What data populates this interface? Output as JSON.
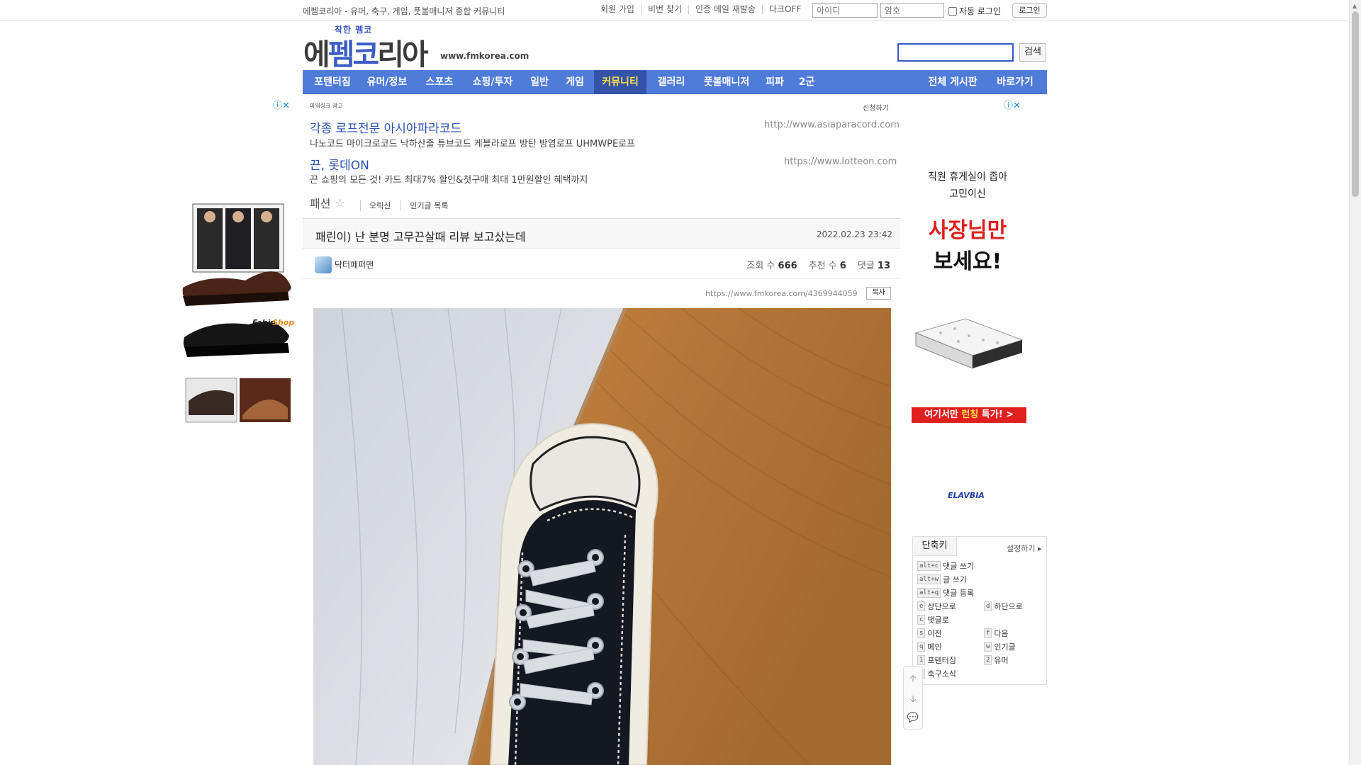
{
  "topbar": {
    "site_desc": "에펨코리아 - 유머, 축구, 게임, 풋볼매니저 종합 커뮤니티",
    "links": [
      "회원 가입",
      "비번 찾기",
      "인증 메일 재발송",
      "다크OFF"
    ],
    "id_placeholder": "아이디",
    "pw_placeholder": "암호",
    "auto_login": "자동 로그인",
    "login_button": "로그인"
  },
  "header": {
    "logo_small": "착한 펨코",
    "logo_text_a": "에",
    "logo_text_b": "펨",
    "logo_text_c": "코",
    "logo_text_d": "리아",
    "url": "www.fmkorea.com",
    "search_button": "검색"
  },
  "nav": {
    "items": [
      "포텐터짐",
      "유머/정보",
      "스포츠",
      "쇼핑/투자",
      "일반",
      "게임",
      "커뮤니티",
      "갤러리",
      "풋볼매니저",
      "피파",
      "2군"
    ],
    "active": "커뮤니티",
    "right_items": [
      "전체 게시판",
      "바로가기"
    ]
  },
  "ads": {
    "powerlink": "파워링크 광고",
    "apply": "신청하기",
    "items": [
      {
        "title": "각종 로프전문 아시아파라코드",
        "url": "http://www.asiaparacord.com",
        "desc": "나노코드 마이크로코드 낙하산줄 튜브코드 케블라로프 방탄 방염로프 UHMWPE로프"
      },
      {
        "title": "끈, 롯데ON",
        "url": "https://www.lotteon.com",
        "desc": "끈 쇼핑의 모든 것! 카드 최대7% 할인&첫구매 최대 1만원할인 혜택까지"
      }
    ]
  },
  "board": {
    "name": "패션",
    "links": [
      "오릭신",
      "인기글 목록"
    ]
  },
  "post": {
    "title": "패린이) 난 분명 고무끈살때 리뷰 보고샀는데",
    "date": "2022.02.23 23:42",
    "author": "닥터페퍼맨",
    "views_label": "조회 수",
    "views": "666",
    "recommend_label": "추천 수",
    "recommend": "6",
    "comments_label": "댓글",
    "comments": "13",
    "permalink": "https://www.fmkorea.com/4369944059",
    "copy_button": "복사"
  },
  "left_ad": {
    "brand": "FahinShop"
  },
  "right_ad": {
    "line1": "직원 휴게실이 좁아",
    "line2": "고민이신",
    "red": "사장님만",
    "black": "보세요!",
    "bar_a": "여기서만 ",
    "bar_b": "런칭",
    "bar_c": " 특가! >",
    "brand": "ELAVBIA"
  },
  "shortcuts": {
    "tab": "단축키",
    "settings": "설정하기",
    "rows": [
      {
        "key": "alt+c",
        "label": "댓글 쓰기"
      },
      {
        "key": "alt+w",
        "label": "글 쓰기"
      },
      {
        "key": "alt+q",
        "label": "댓글 등록"
      },
      {
        "key": "e",
        "label": "상단으로"
      },
      {
        "key": "d",
        "label": "하단으로"
      },
      {
        "key": "c",
        "label": "댓글로"
      },
      {
        "key": "s",
        "label": "이전"
      },
      {
        "key": "f",
        "label": "다음"
      },
      {
        "key": "q",
        "label": "메인"
      },
      {
        "key": "w",
        "label": "인기글"
      },
      {
        "key": "1",
        "label": "포텐터짐"
      },
      {
        "key": "2",
        "label": "유머"
      },
      {
        "key": "3",
        "label": "축구소식"
      }
    ]
  },
  "colors": {
    "nav_bg": "#4f7bd9",
    "nav_active_bg": "#3452a8",
    "nav_active_text": "#ffe34a",
    "ad_title": "#2c4fb5",
    "promo_red": "#e01f1f"
  }
}
